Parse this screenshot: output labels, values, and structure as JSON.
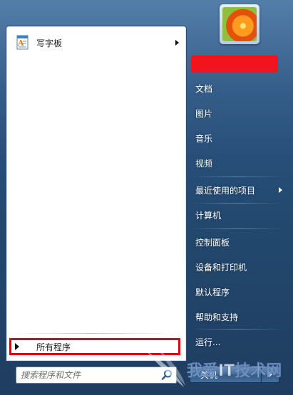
{
  "start_menu": {
    "pinned_programs": [
      {
        "label": "写字板",
        "icon": "wordpad-icon",
        "has_submenu": true
      }
    ],
    "all_programs_label": "所有程序",
    "search": {
      "placeholder": "搜索程序和文件",
      "icon": "search-icon"
    }
  },
  "right_pane": {
    "items": [
      {
        "label": "文档"
      },
      {
        "label": "图片"
      },
      {
        "label": "音乐"
      },
      {
        "label": "视频"
      },
      {
        "label": "最近使用的项目",
        "has_submenu": true
      },
      {
        "label": "计算机"
      },
      {
        "label": "控制面板"
      },
      {
        "label": "设备和打印机"
      },
      {
        "label": "默认程序"
      },
      {
        "label": "帮助和支持"
      },
      {
        "label": "运行..."
      }
    ],
    "user_avatar": "flower-picture"
  },
  "shutdown": {
    "label": "关机"
  },
  "watermark_text": "我爱IT技术网",
  "colors": {
    "highlight_border": "#e00010",
    "redaction": "#f2141c",
    "frame": "#2a5583"
  }
}
